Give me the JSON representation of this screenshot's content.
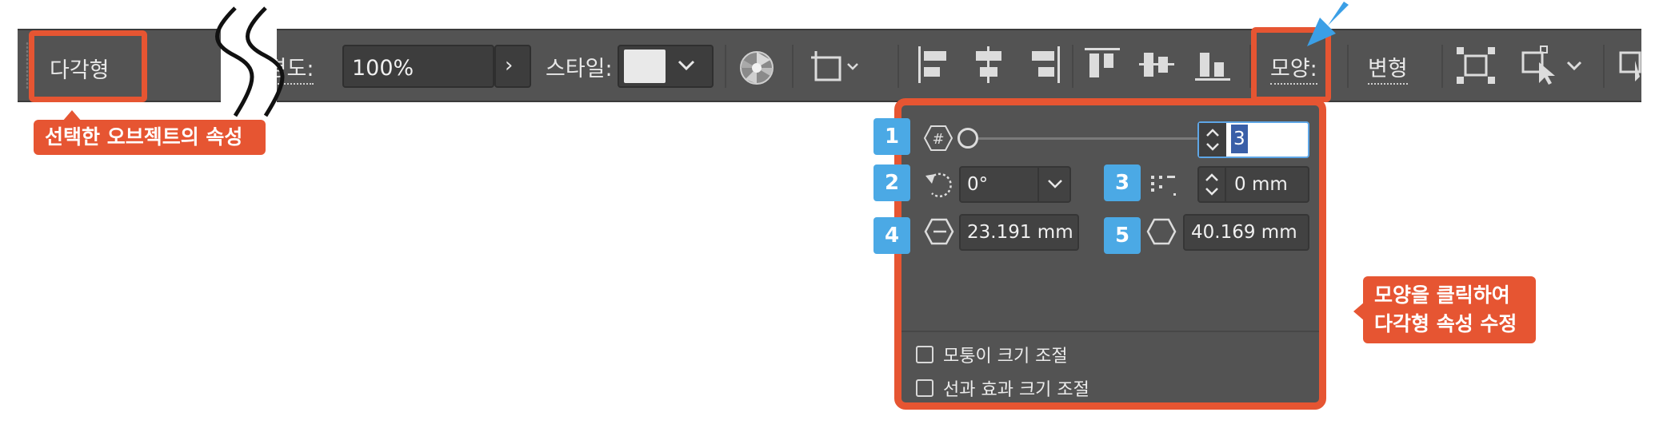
{
  "toolbar": {
    "context_label": "다각형",
    "opacity_label": "불투명도:",
    "opacity_value": "100%",
    "style_label": "스타일:",
    "shape_label": "모양:",
    "transform_label": "변형"
  },
  "callouts": {
    "selected_object": "선택한 오브젝트의 속성",
    "click_shape_line1": "모양을 클릭하여",
    "click_shape_line2": "다각형 속성 수정"
  },
  "popup": {
    "badges": [
      "1",
      "2",
      "3",
      "4",
      "5"
    ],
    "sides_value": "3",
    "rotation_value": "0°",
    "spacing_value": "0 mm",
    "inner_size_value": "23.191 mm",
    "outer_size_value": "40.169 mm",
    "checkbox_corner_scale": "모퉁이 크기 조절",
    "checkbox_stroke_scale": "선과 효과 크기 조절"
  },
  "colors": {
    "toolbar_bg": "#535353",
    "highlight": "#e65532",
    "badge": "#4ba9e5",
    "arrow": "#3b9fe6"
  }
}
